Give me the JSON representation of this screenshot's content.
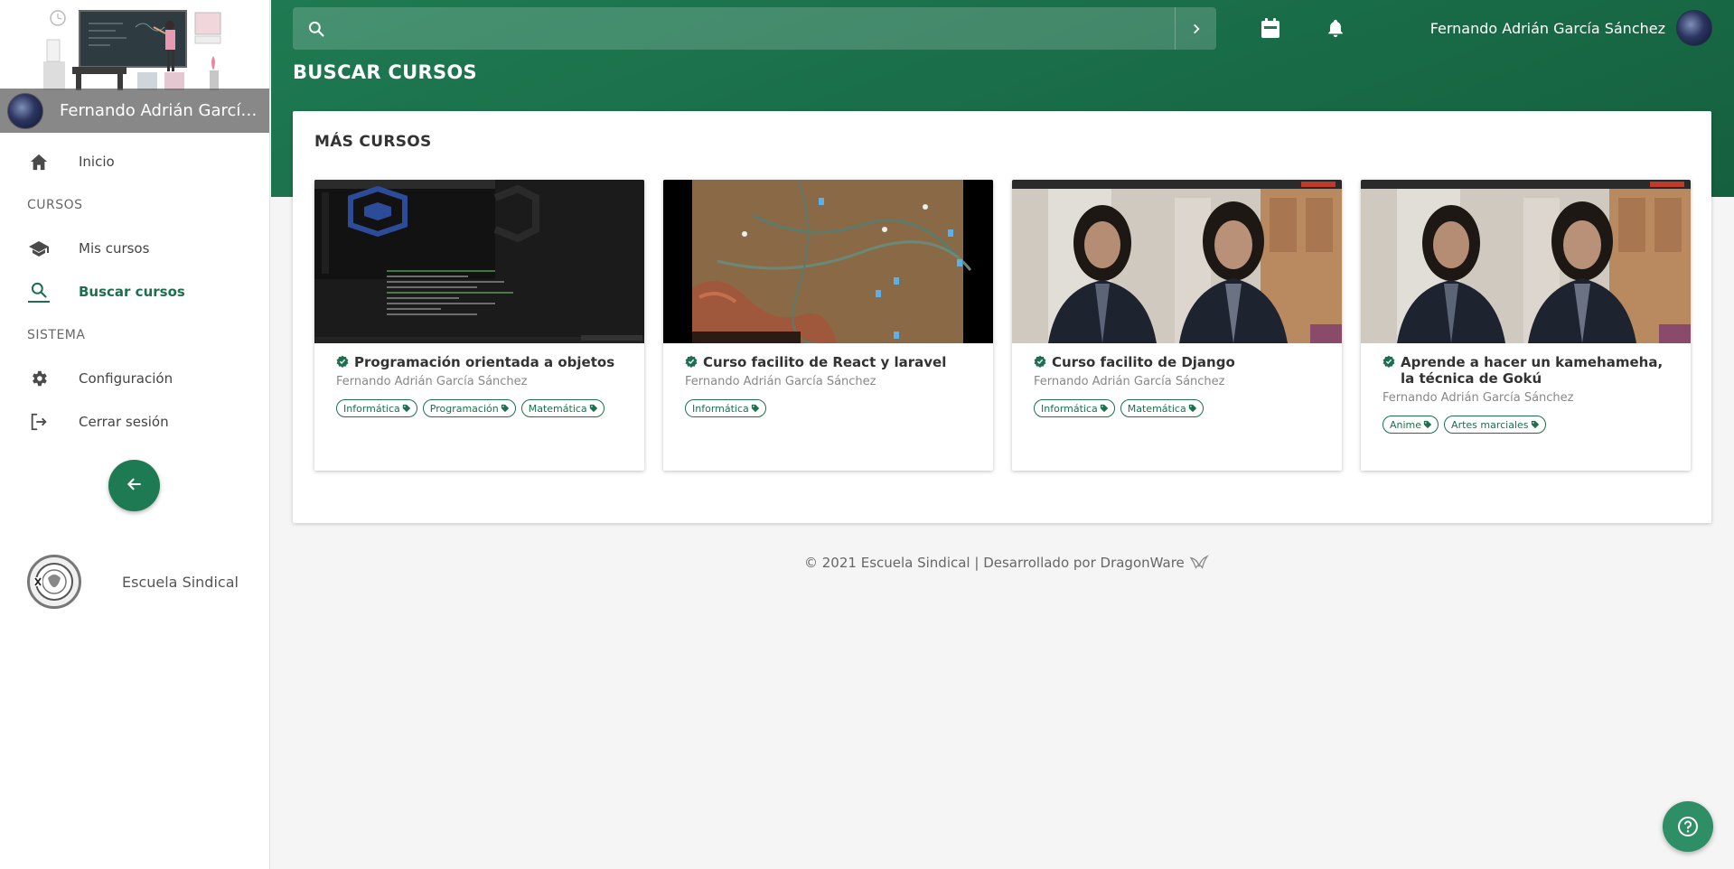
{
  "sidebar": {
    "user_name": "Fernando Adrián García Sánchez",
    "items": {
      "inicio": "Inicio",
      "cursos_section": "CURSOS",
      "mis_cursos": "Mis cursos",
      "buscar_cursos": "Buscar cursos",
      "sistema_section": "SISTEMA",
      "configuracion": "Configuración",
      "cerrar_sesion": "Cerrar sesión"
    },
    "school_name": "Escuela Sindical",
    "active_item": "buscar_cursos"
  },
  "header": {
    "search_placeholder": "",
    "user_name": "Fernando Adrián García Sánchez",
    "page_title": "BUSCAR CURSOS"
  },
  "main": {
    "section_title": "MÁS CURSOS",
    "courses": [
      {
        "title": "Programación orientada a objetos",
        "author": "Fernando Adrián García Sánchez",
        "tags": [
          "Informática",
          "Programación",
          "Matemática"
        ]
      },
      {
        "title": "Curso facilito de React y laravel",
        "author": "Fernando Adrián García Sánchez",
        "tags": [
          "Informática"
        ]
      },
      {
        "title": "Curso facilito de Django",
        "author": "Fernando Adrián García Sánchez",
        "tags": [
          "Informática",
          "Matemática"
        ]
      },
      {
        "title": "Aprende a hacer un kamehameha, la técnica de Gokú",
        "author": "Fernando Adrián García Sánchez",
        "tags": [
          "Anime",
          "Artes marciales"
        ]
      }
    ]
  },
  "footer": {
    "text": "© 2021 Escuela Sindical | Desarrollado por DragonWare"
  },
  "colors": {
    "primary": "#1e7a52",
    "primary_dark": "#15603f",
    "accent_text": "#1d6f4f",
    "help_button": "#2e8f67"
  },
  "icons": {
    "search": "search-icon",
    "go": "chevron-right-icon",
    "calendar": "calendar-icon",
    "notifications": "bell-icon",
    "home": "home-icon",
    "courses": "graduation-cap-icon",
    "settings": "gear-icon",
    "logout": "logout-icon",
    "back": "arrow-left-icon",
    "verified": "verified-check-icon",
    "tag": "tag-icon",
    "help": "help-icon"
  }
}
